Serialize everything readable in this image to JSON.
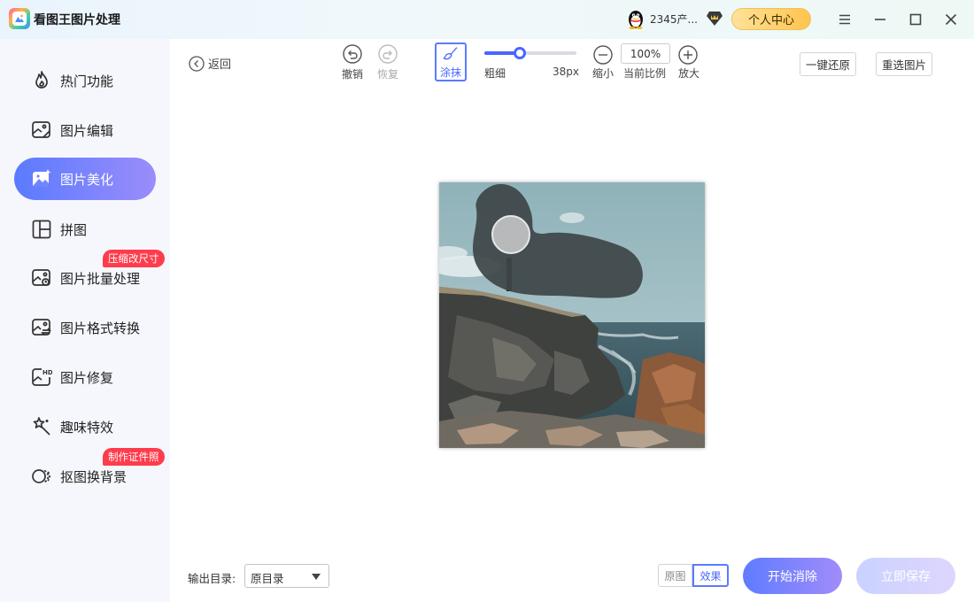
{
  "app": {
    "title": "看图王图片处理"
  },
  "header": {
    "user_name": "2345产...",
    "personal_center": "个人中心",
    "window_buttons": [
      "menu-icon",
      "minimize-icon",
      "maximize-icon",
      "close-icon"
    ]
  },
  "sidebar": {
    "items": [
      {
        "label": "热门功能",
        "icon": "flame-icon"
      },
      {
        "label": "图片编辑",
        "icon": "image-edit-icon"
      },
      {
        "label": "图片美化",
        "icon": "image-beautify-icon",
        "active": true
      },
      {
        "label": "拼图",
        "icon": "collage-icon"
      },
      {
        "label": "图片批量处理",
        "icon": "image-batch-icon",
        "badge": "压缩改尺寸"
      },
      {
        "label": "图片格式转换",
        "icon": "image-convert-icon"
      },
      {
        "label": "图片修复",
        "icon": "image-hd-icon"
      },
      {
        "label": "趣味特效",
        "icon": "magic-wand-icon"
      },
      {
        "label": "抠图换背景",
        "icon": "cutout-icon",
        "badge": "制作证件照"
      }
    ]
  },
  "toolbar": {
    "back": "返回",
    "undo": "撤销",
    "redo": "恢复",
    "smear": "涂抹",
    "thickness_label": "粗细",
    "thickness_value": "38px",
    "thickness_fraction": 0.38,
    "zoom_out": "缩小",
    "ratio_value": "100%",
    "ratio_label": "当前比例",
    "zoom_in": "放大",
    "restore_all": "一键还原",
    "reselect": "重选图片"
  },
  "bottom": {
    "output_label": "输出目录:",
    "output_value": "原目录",
    "view_original": "原图",
    "view_effect": "效果",
    "start": "开始消除",
    "save": "立即保存"
  },
  "colors": {
    "accent": "#4a66ff",
    "badge": "#ff3c4c",
    "vip_gold": "#ffc44d"
  }
}
